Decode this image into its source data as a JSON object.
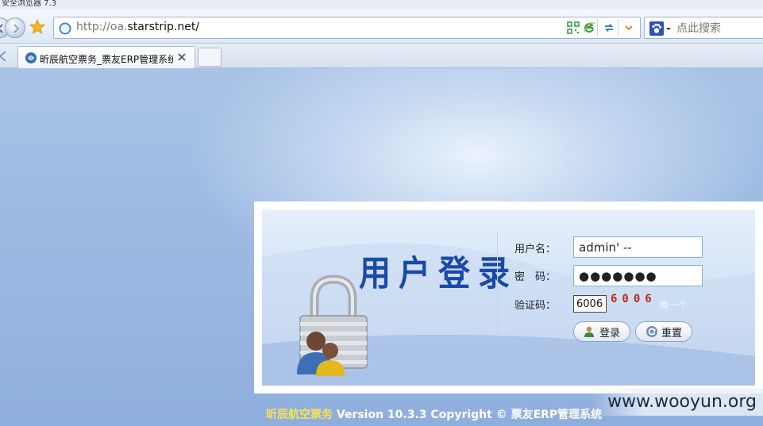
{
  "browser": {
    "window_title": "安全浏览器 7.3",
    "address": {
      "url_prefix": "http://oa.",
      "url_domain": "starstrip.net/"
    },
    "search": {
      "placeholder": "点此搜索"
    },
    "tabs": [
      {
        "title": "昕辰航空票务_票友ERP管理系统",
        "active": true
      }
    ]
  },
  "login": {
    "title": "用户登录",
    "username_label": "用户名：",
    "username_value": "admin' --",
    "password_label": "密　码：",
    "password_value": "●●●●●●●",
    "captcha_label": "验证码：",
    "captcha_value": "6006",
    "captcha_image_text": "6006",
    "captcha_refresh": "换一个",
    "login_button": "登录",
    "reset_button": "重置"
  },
  "footer": {
    "company": "昕辰航空票务",
    "version_text": " Version 10.3.3 Copyright © 票友ERP管理系统"
  },
  "watermark": "www.wooyun.org",
  "colors": {
    "page_bg": "#8fb0df",
    "title_blue": "#1a4aa8",
    "captcha_red": "#c42a1a",
    "footer_yellow": "#f6e25a"
  },
  "icons": [
    "back-icon",
    "forward-icon",
    "favorite-star-icon",
    "globe-icon",
    "qr-code-icon",
    "ie-compat-icon",
    "refresh-icon",
    "dropdown-icon",
    "paw-search-icon",
    "tab-favicon",
    "close-icon",
    "padlock-users-icon",
    "user-login-icon",
    "reset-icon"
  ]
}
